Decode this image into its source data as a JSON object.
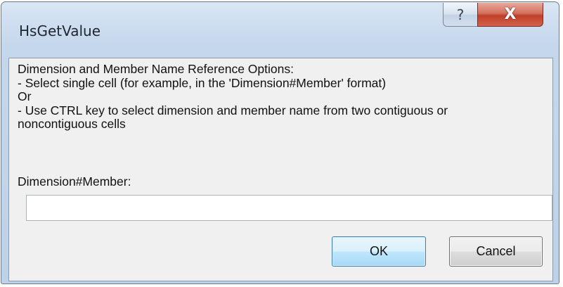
{
  "window": {
    "title": "HsGetValue",
    "help_button_glyph": "?",
    "close_button_glyph": "X"
  },
  "description": {
    "heading": "Dimension and Member Name Reference Options:",
    "option1": "- Select single cell (for example, in the 'Dimension#Member' format)",
    "or": "Or",
    "option2_line1": "- Use CTRL key to select dimension and member name from two contiguous or",
    "option2_line2": "noncontiguous cells"
  },
  "field": {
    "label": "Dimension#Member:",
    "value": "",
    "placeholder": ""
  },
  "buttons": {
    "ok_label": "OK",
    "cancel_label": "Cancel"
  },
  "colors": {
    "titlebar": "#c5d7ec",
    "client_background": "#f0f0f0",
    "close_button": "#c0402a",
    "default_button_border": "#3c7fb1"
  },
  "icons": {
    "help": "help-icon",
    "close": "close-icon"
  }
}
